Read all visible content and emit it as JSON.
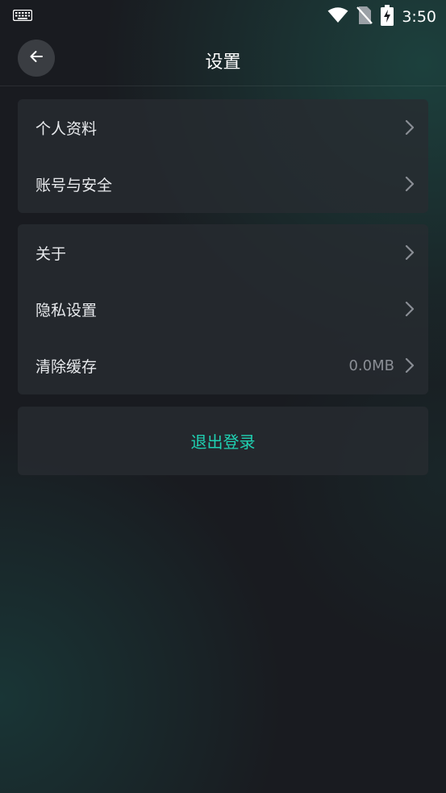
{
  "status_bar": {
    "time": "3:50",
    "icons": [
      "keyboard-icon",
      "wifi-icon",
      "no-sim-icon",
      "battery-charging-icon"
    ]
  },
  "header": {
    "title": "设置",
    "back_icon": "arrow-left-icon"
  },
  "groups": [
    {
      "items": [
        {
          "label": "个人资料"
        },
        {
          "label": "账号与安全"
        }
      ]
    },
    {
      "items": [
        {
          "label": "关于"
        },
        {
          "label": "隐私设置"
        },
        {
          "label": "清除缓存",
          "value": "0.0MB"
        }
      ]
    }
  ],
  "logout": {
    "label": "退出登录",
    "color": "#1fd1b2"
  }
}
